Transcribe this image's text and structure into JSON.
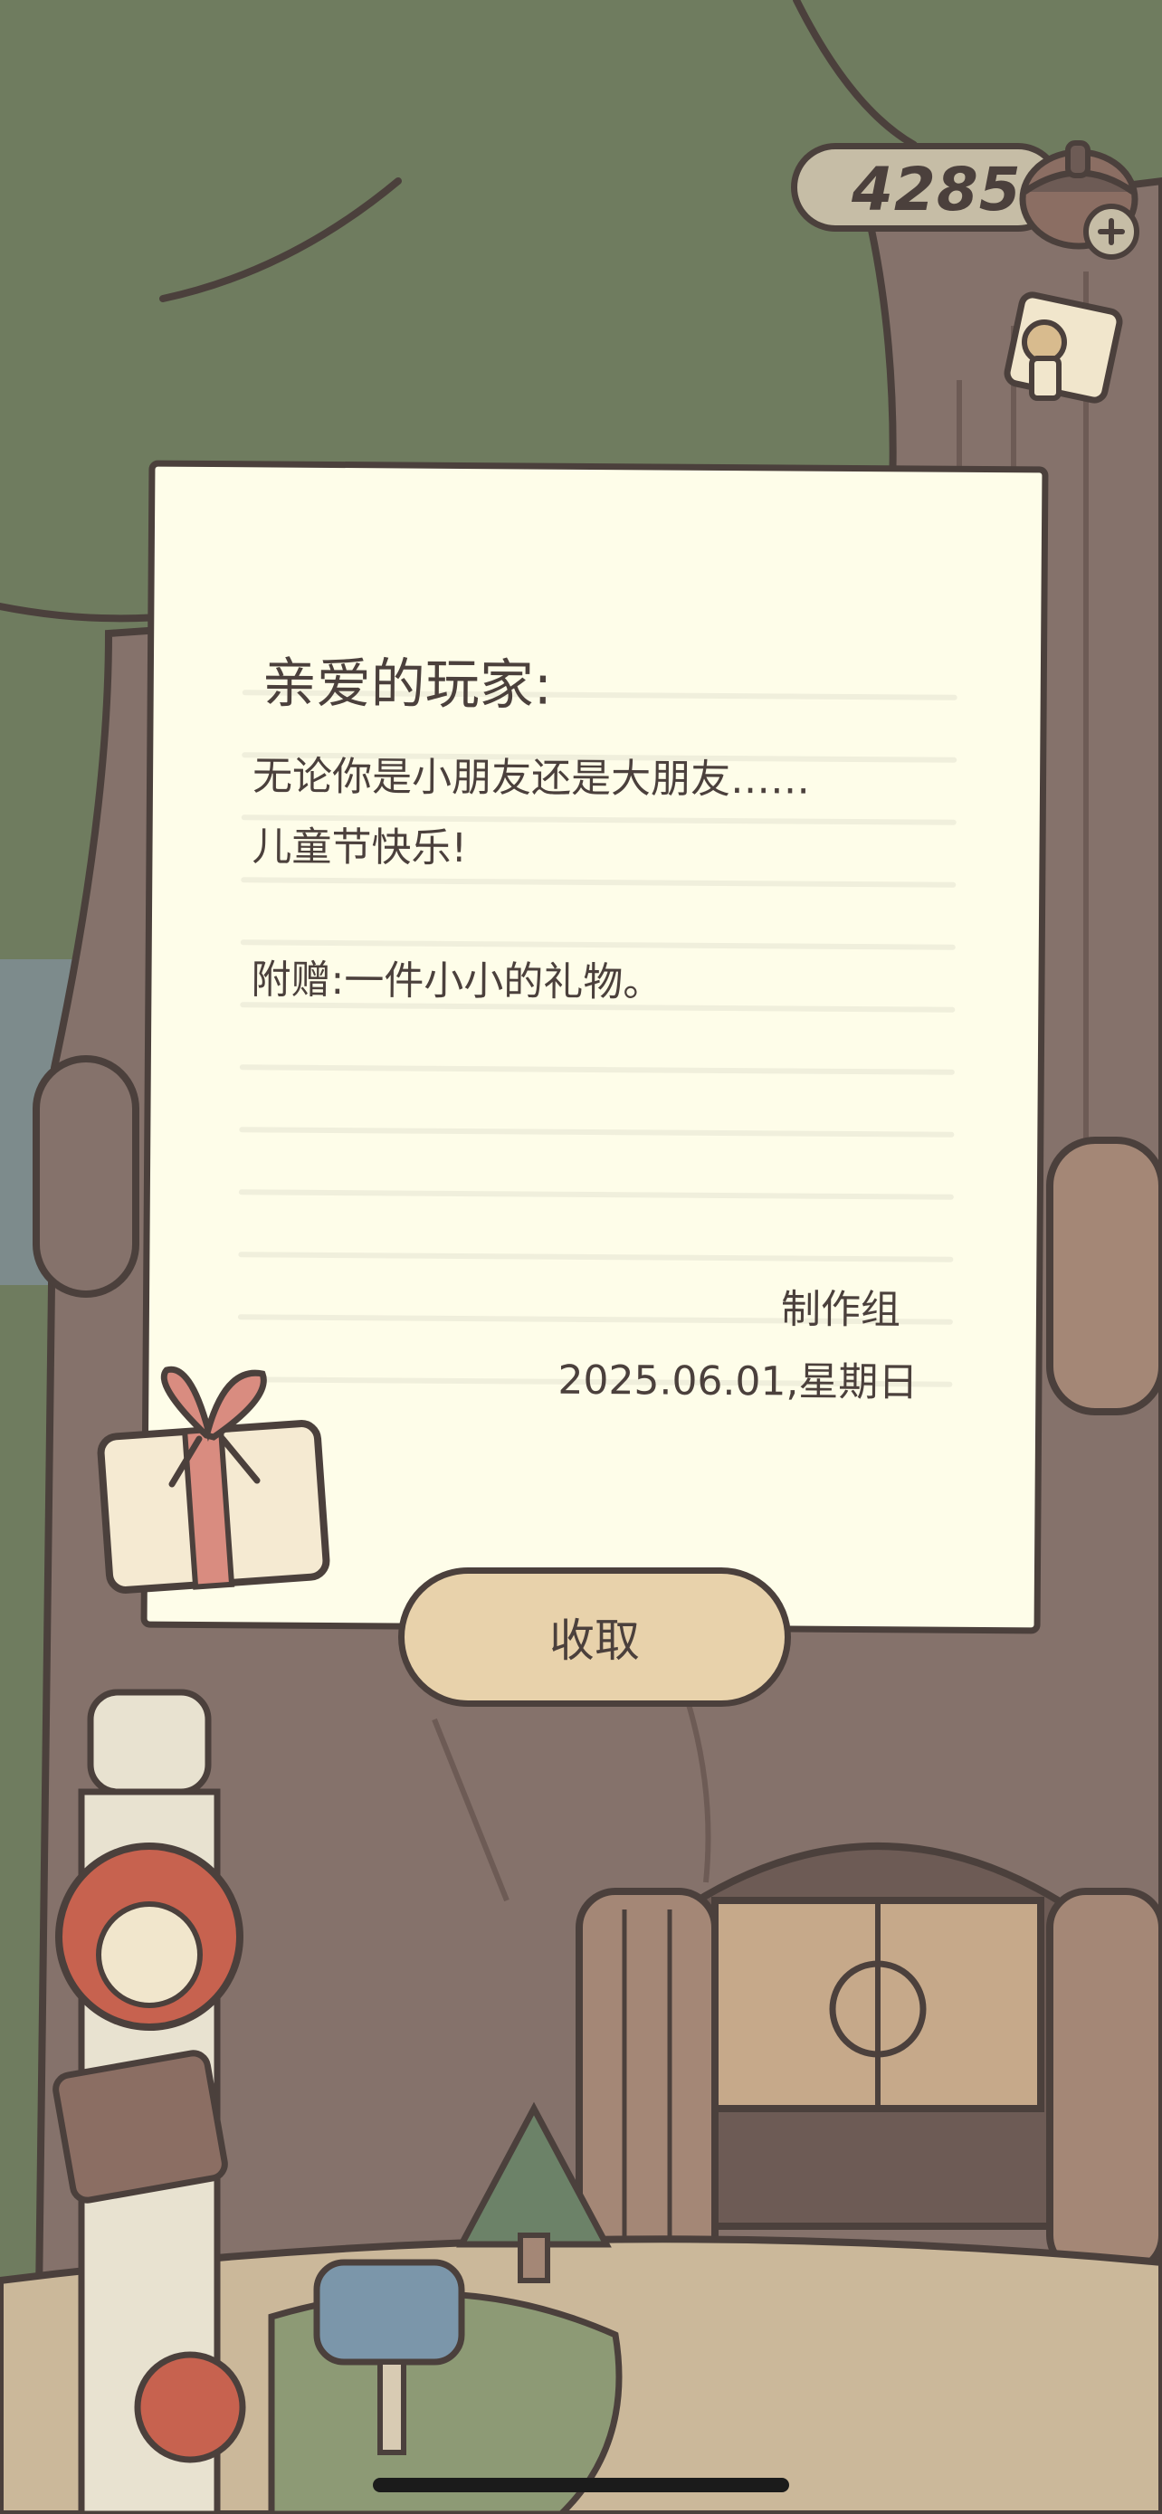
{
  "hud": {
    "acorn_count": "4285",
    "acorn_icon": "acorn-icon",
    "add_icon": "plus-icon",
    "coupon_icon": "coupon-icon"
  },
  "letter": {
    "salutation": "亲爱的玩家:",
    "line1": "无论你是小朋友还是大朋友……",
    "line2": "儿童节快乐!",
    "line3": "附赠:一件小小的礼物。",
    "signer": "制作组",
    "date": "2025.06.01,星期日",
    "attachment_icon": "gift-box-icon"
  },
  "actions": {
    "collect_label": "收取"
  },
  "colors": {
    "outline": "#4b403c",
    "paper": "#fefde9",
    "button": "#e8d2ab",
    "tree_canopy": "#6f7c5f",
    "trunk": "#85726b"
  }
}
